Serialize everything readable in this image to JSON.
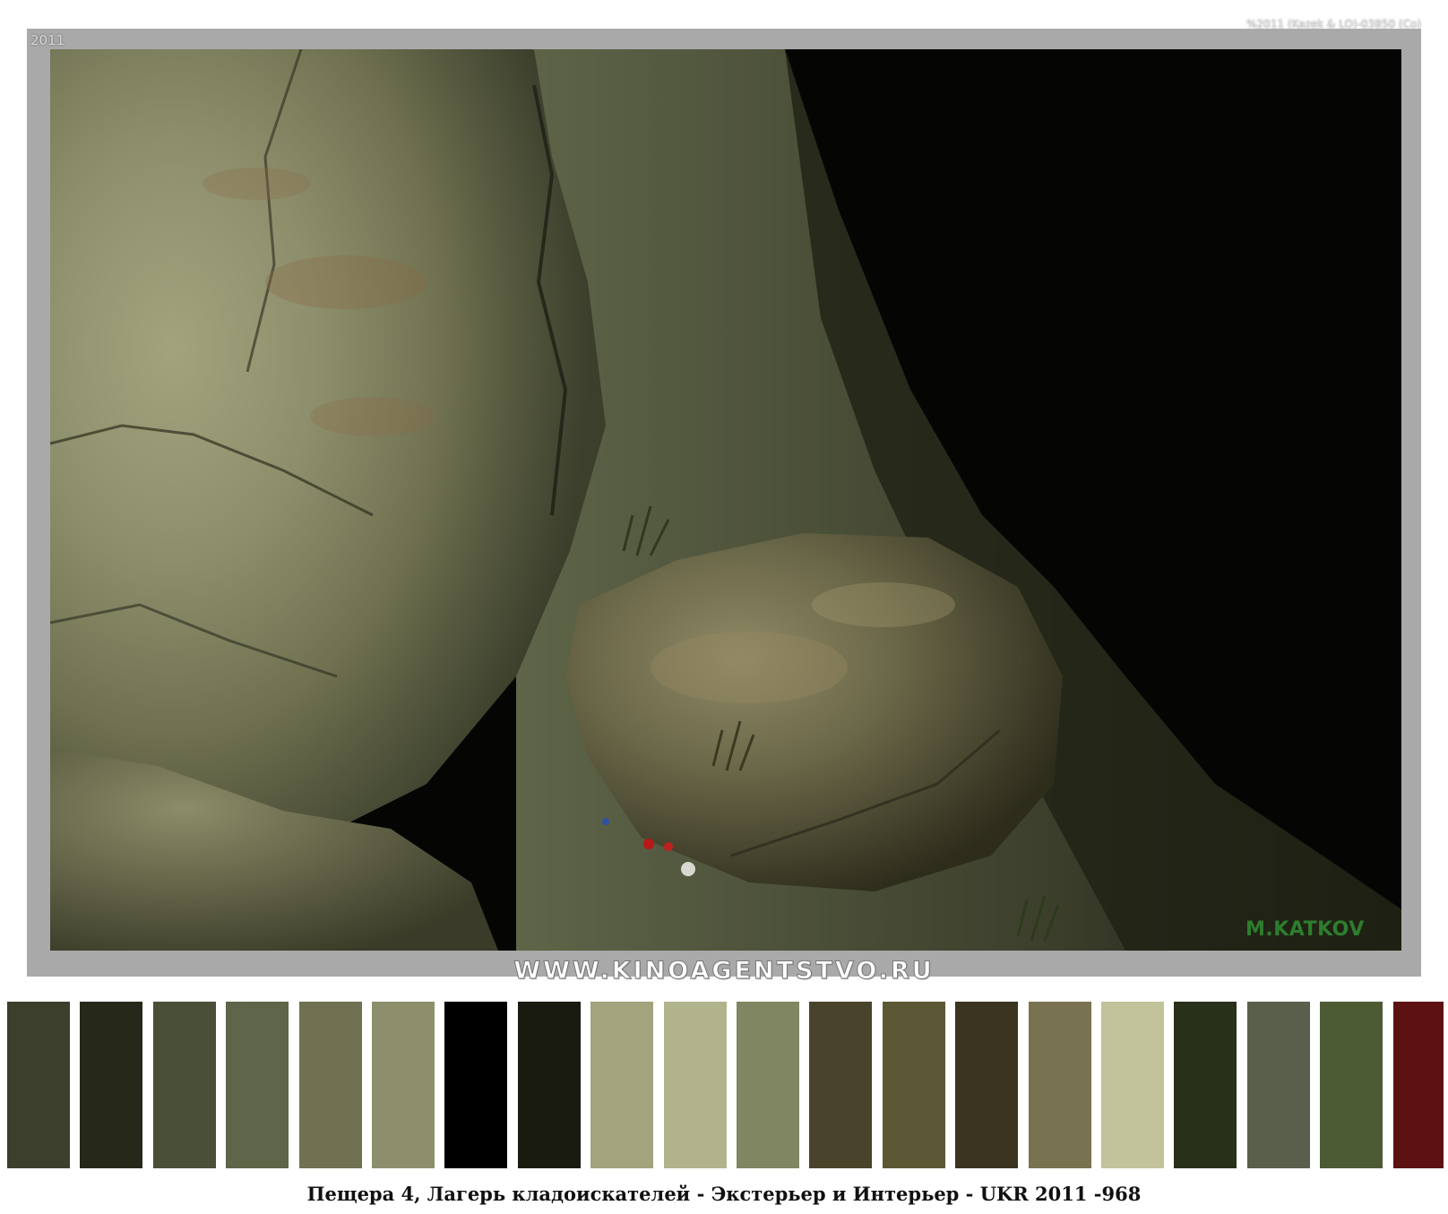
{
  "stamps": {
    "year": "2011",
    "copyright": "%2011 (Kazek & LO)-03850 (Co)"
  },
  "photo": {
    "description": "cave-rocks-photo",
    "credit": "M.KATKOV",
    "diagonal_watermark": "www.kinoagentstvo.ru"
  },
  "site": {
    "url": "WWW.KINOAGENTSTVO.RU"
  },
  "palette": {
    "colors": [
      "#3c3f2c",
      "#26281a",
      "#4a4f38",
      "#5e6548",
      "#6f7150",
      "#8d8f6c",
      "#000000",
      "#1a1b10",
      "#a3a37d",
      "#b1b38c",
      "#7f8661",
      "#4a432b",
      "#5c5836",
      "#3a3421",
      "#797251",
      "#c2c39b",
      "#283019",
      "#5a5f4b",
      "#4d5b34",
      "#5c1212"
    ]
  },
  "caption": {
    "text": "Пещера 4, Лагерь кладоискателей - Экстерьер и Интерьер - UKR 2011 -968"
  }
}
